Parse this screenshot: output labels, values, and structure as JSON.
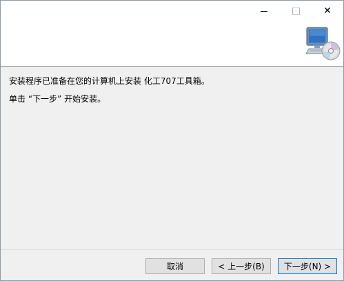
{
  "titlebar": {
    "minimize_icon": "minimize-icon",
    "maximize_icon": "maximize-icon",
    "close_symbol": "✕"
  },
  "header": {
    "icon": "computer-cd-icon"
  },
  "body": {
    "line1": "安装程序已准备在您的计算机上安装 化工707工具箱。",
    "line2": "单击 “下一步” 开始安装。"
  },
  "buttons": {
    "cancel": "取消",
    "back": "< 上一步(B)",
    "next": "下一步(N) >"
  }
}
